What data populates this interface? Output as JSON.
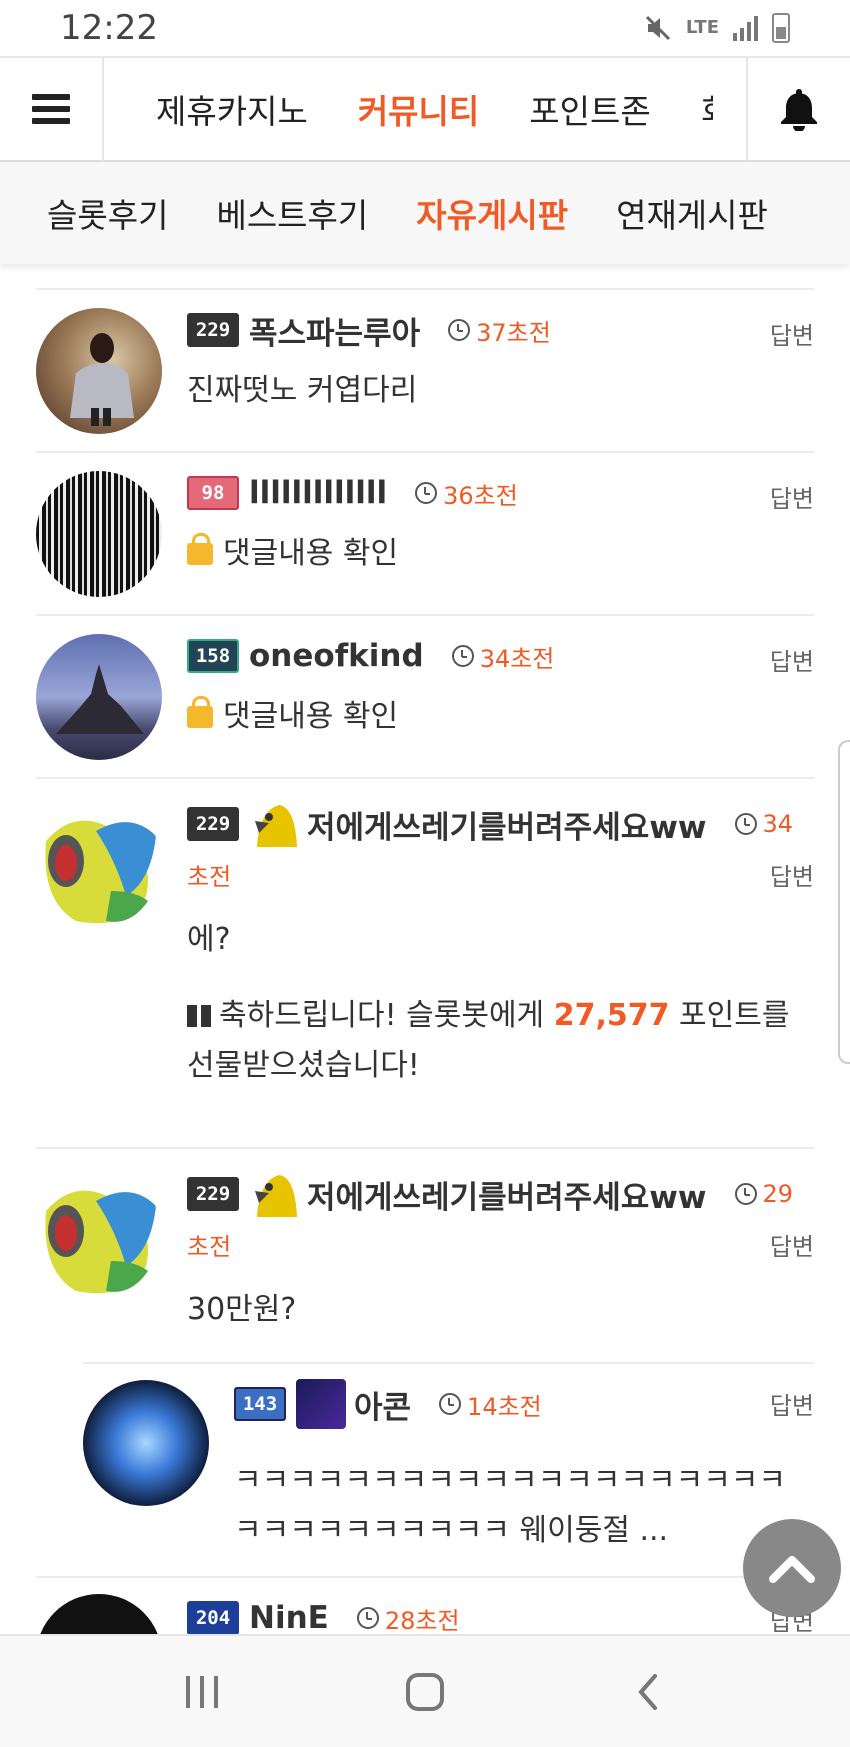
{
  "status_bar": {
    "time": "12:22",
    "network": "LTE"
  },
  "top_nav": {
    "tabs": [
      "제휴카지노",
      "커뮤니티",
      "포인트존",
      "회"
    ],
    "active_index": 1
  },
  "sub_nav": {
    "tabs": [
      "슬롯후기",
      "베스트후기",
      "자유게시판",
      "연재게시판"
    ],
    "active_index": 2
  },
  "comments": [
    {
      "level": "229",
      "username": "폭스파는루아",
      "time": "37초전",
      "reply_label": "답변",
      "text": "진짜떳노 커엽다리"
    },
    {
      "level": "98",
      "username": "lllllllllllll",
      "time": "36초전",
      "reply_label": "답변",
      "text": "댓글내용 확인",
      "locked": true
    },
    {
      "level": "158",
      "username": "oneofkind",
      "time": "34초전",
      "reply_label": "답변",
      "text": "댓글내용 확인",
      "locked": true
    },
    {
      "level": "229",
      "username": "저에게쓰레기를버려주세요ww",
      "time_a": "34",
      "time_b": "초전",
      "reply_label": "답변",
      "text": "에?",
      "gift_text_a": "축하드립니다! 슬롯봇에게 ",
      "gift_points": "27,577",
      "gift_text_b": " 포인트를",
      "gift_text_c": "선물받으셨습니다!"
    },
    {
      "level": "229",
      "username": "저에게쓰레기를버려주세요ww",
      "time_a": "29",
      "time_b": "초전",
      "reply_label": "답변",
      "text": "30만원?"
    },
    {
      "level": "143",
      "username": "아콘",
      "time": "14초전",
      "reply_label": "답변",
      "text_line1": "ㅋㅋㅋㅋㅋㅋㅋㅋㅋㅋㅋㅋㅋㅋㅋㅋㅋㅋㅋㅋ",
      "text_line2": "ㅋㅋㅋㅋㅋㅋㅋㅋㅋㅋ 웨이둥절 ..."
    },
    {
      "level": "204",
      "username": "NinE",
      "time": "28초전",
      "reply_label": "답변"
    }
  ],
  "colors": {
    "accent": "#f05a24",
    "text": "#222222",
    "muted": "#666666"
  }
}
